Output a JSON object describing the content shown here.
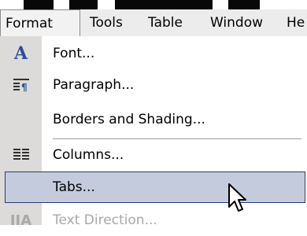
{
  "menubar": {
    "items": [
      "Format",
      "Tools",
      "Table",
      "Window",
      "He"
    ]
  },
  "format_menu": {
    "items": [
      {
        "label": "Font...",
        "icon": "font-icon"
      },
      {
        "label": "Paragraph...",
        "icon": "paragraph-icon"
      },
      {
        "label": "Borders and Shading...",
        "icon": ""
      },
      {
        "label": "Columns...",
        "icon": "columns-icon"
      },
      {
        "label": "Tabs...",
        "icon": "",
        "highlighted": true
      },
      {
        "label": "Text Direction...",
        "icon": "text-direction-icon",
        "disabled": true
      }
    ]
  },
  "colors": {
    "highlight": "#c3cbdd",
    "highlight_border": "#2b3c78",
    "icon_column": "#dcdbd9",
    "menubar": "#ececec"
  }
}
